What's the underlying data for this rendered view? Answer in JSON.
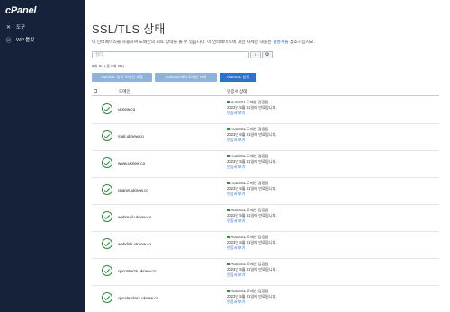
{
  "sidebar": {
    "logo": "cPanel",
    "items": [
      {
        "label": "도구",
        "icon": "tools-icon"
      },
      {
        "label": "WP 툴킷",
        "icon": "wordpress-icon"
      }
    ]
  },
  "page": {
    "title": "SSL/TLS 상태",
    "description": "이 인터페이스를 사용하여 도메인의 SSL 상태를 볼 수 있습니다. 이 인터페이스에 대한 자세한 내용은 ",
    "description_link": "설명서를",
    "description_suffix": " 참조하십시오."
  },
  "search": {
    "placeholder": "필터"
  },
  "status_line": "8개 표시 중 8개 표시",
  "actions": {
    "include_label": "AutoSSL 항목 도메인 포함",
    "exclude_label": "AutoSSL에서 도메인 제외",
    "run_label": "AutoSSL 실행"
  },
  "table": {
    "col_domain": "도메인",
    "col_status": "인증서 상태",
    "rows": [
      {
        "domain": "uknew.co",
        "status": "AutoSSL 도메인 검증됨",
        "expiry": "2023년 5월 31일에 만료됩니다.",
        "more": "인증서 보기"
      },
      {
        "domain": "mail.uknew.co",
        "status": "AutoSSL 도메인 검증됨",
        "expiry": "2023년 5월 31일에 만료됩니다.",
        "more": "인증서 보기"
      },
      {
        "domain": "www.uknew.co",
        "status": "AutoSSL 도메인 검증됨",
        "expiry": "2023년 5월 31일에 만료됩니다.",
        "more": "인증서 보기"
      },
      {
        "domain": "cpanel.uknew.co",
        "status": "AutoSSL 도메인 검증됨",
        "expiry": "2023년 5월 31일에 만료됩니다.",
        "more": "인증서 보기"
      },
      {
        "domain": "webmail.uknew.co",
        "status": "AutoSSL 도메인 검증됨",
        "expiry": "2023년 5월 31일에 만료됩니다.",
        "more": "인증서 보기"
      },
      {
        "domain": "webdisk.uknew.co",
        "status": "AutoSSL 도메인 검증됨",
        "expiry": "2023년 5월 31일에 만료됩니다.",
        "more": "인증서 보기"
      },
      {
        "domain": "cpcontacts.uknew.co",
        "status": "AutoSSL 도메인 검증됨",
        "expiry": "2023년 5월 31일에 만료됩니다.",
        "more": "인증서 보기"
      },
      {
        "domain": "cpcalendars.uknew.co",
        "status": "AutoSSL 도메인 검증됨",
        "expiry": "2023년 5월 31일에 만료됩니다.",
        "more": "인증서 보기"
      }
    ]
  },
  "colors": {
    "sidebar_bg": "#16223a",
    "primary_button": "#2f72c8",
    "disabled_button": "#8fb2d9",
    "valid_green": "#2e8b3f",
    "link": "#1f6fc5"
  }
}
